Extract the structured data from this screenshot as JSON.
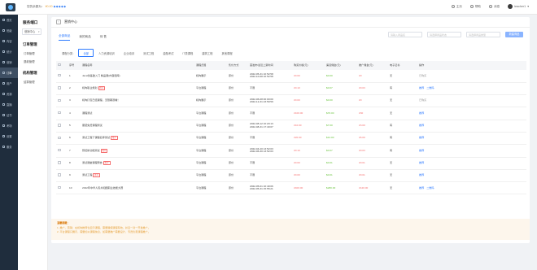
{
  "topbar": {
    "deposit_label": "您的余额为：",
    "deposit_amount": "¥0.00",
    "stars": "◆◆◆◆◆",
    "links": [
      {
        "label": "主页",
        "icon": "home-icon"
      },
      {
        "label": "帮助",
        "icon": "help-icon"
      },
      {
        "label": "消息",
        "icon": "bell-icon"
      }
    ],
    "username": "teacher1"
  },
  "leftnav": {
    "items": [
      {
        "label": "首页",
        "icon": "home-icon"
      },
      {
        "label": "班级",
        "icon": "class-icon"
      },
      {
        "label": "内容",
        "icon": "content-icon"
      },
      {
        "label": "统计",
        "icon": "chart-icon"
      },
      {
        "label": "营销",
        "icon": "marketing-icon"
      },
      {
        "label": "订单",
        "icon": "order-icon",
        "active": true
      },
      {
        "label": "用户",
        "icon": "user-icon"
      },
      {
        "label": "资源",
        "icon": "resource-icon"
      },
      {
        "label": "直播",
        "icon": "live-icon"
      },
      {
        "label": "证书",
        "icon": "certificate-icon"
      },
      {
        "label": "考场",
        "icon": "exam-icon"
      },
      {
        "label": "设置",
        "icon": "settings-icon"
      },
      {
        "label": "服务",
        "icon": "service-icon"
      }
    ]
  },
  "subnav": {
    "title": "服务端口",
    "select_value": "营销中心",
    "groups": [
      {
        "title": "订单管理",
        "links": [
          "订单管理",
          "退款管理"
        ]
      },
      {
        "title": "机构管理",
        "links": [
          "结算管理"
        ]
      }
    ]
  },
  "panel": {
    "title": "营销中心",
    "tabs": [
      {
        "label": "全部商品",
        "active": true
      },
      {
        "label": "我的商品",
        "active": false
      },
      {
        "label": "待 售",
        "active": false
      }
    ],
    "search_placeholder": "请输入商品名",
    "status_placeholder": "请选择商品状态",
    "type_placeholder": "请选择商品类型",
    "add_button": "新建商品",
    "type_label": "课程分类：",
    "types": [
      "全部",
      "人力资源培训",
      "企业培训",
      "测试工程",
      "金融考试",
      "IT类课程",
      "建筑工程",
      "其他课程"
    ]
  },
  "table": {
    "headers": [
      "序号",
      "课程名称",
      "课程归属",
      "售价方式",
      "首发布/最近上架时间",
      "购买价格(元)",
      "渠道佣金(元)",
      "推广佣金(元)",
      "电子证书",
      "操作"
    ],
    "rows": [
      {
        "no": "1",
        "name": "Java零基础入门 精品课(内容题库)",
        "tag": "",
        "owner": "机构展示",
        "mode": "原价",
        "time1": "2022-05-31 10:52:58",
        "time2": "2022-10-08 10:52:58",
        "price": "¥0.00",
        "channel": "$0.00",
        "promo": "¥0",
        "cert": "无",
        "ops": [
          "已购买"
        ],
        "ops_gray": true
      },
      {
        "no": "2",
        "name": "机构职业规划",
        "tag": "推荐",
        "owner": "平台课程",
        "mode": "原价",
        "time1": "不限",
        "time2": "",
        "price": "¥0.10",
        "channel": "$0.07",
        "promo": "¥0.03",
        "cert": "有",
        "ops": [
          "推荐",
          "二维码"
        ],
        "ops_gray": false
      },
      {
        "no": "3",
        "name": "机构打包已结课程，无限期观看！",
        "tag": "",
        "owner": "机构展示",
        "mode": "原价",
        "time1": "2022-06-08 00:00:00",
        "time2": "2022-12-31 23:59:59",
        "price": "¥0.00",
        "channel": "$0.00",
        "promo": "¥0",
        "cert": "无",
        "ops": [
          "已购买"
        ],
        "ops_gray": true
      },
      {
        "no": "4",
        "name": "课程测试",
        "tag": "",
        "owner": "平台课程",
        "mode": "原价",
        "time1": "不限",
        "time2": "",
        "price": "¥100.00",
        "channel": "$70.00",
        "promo": "¥30",
        "cert": "无",
        "ops": [
          "推荐"
        ],
        "ops_gray": false
      },
      {
        "no": "5",
        "name": "服装免费课程测试",
        "tag": "",
        "owner": "平台课程",
        "mode": "原价",
        "time1": "2022-08-12 10:20:13",
        "time2": "2022-08-31 17:40:07",
        "price": "¥10.00",
        "channel": "$7.00",
        "promo": "¥3.00",
        "cert": "有",
        "ops": [
          "推荐"
        ],
        "ops_gray": false
      },
      {
        "no": "6",
        "name": "测试工程下课程名称测试",
        "tag": "推荐",
        "owner": "平台课程",
        "mode": "原价",
        "time1": "不限",
        "time2": "",
        "price": "¥20.00",
        "channel": "$14.00",
        "promo": "¥6.00",
        "cert": "有",
        "ops": [
          "推荐"
        ],
        "ops_gray": false
      },
      {
        "no": "7",
        "name": "预览新功能测试",
        "tag": "推荐",
        "owner": "平台课程",
        "mode": "原价",
        "time1": "2022-04-20 13:52:03",
        "time2": "2022-06-30 13:52:03",
        "price": "¥0.10",
        "channel": "$0.07",
        "promo": "¥0.03",
        "cert": "有",
        "ops": [
          "推荐"
        ],
        "ops_gray": false
      },
      {
        "no": "8",
        "name": "测试课堂课程预告",
        "tag": "推荐",
        "owner": "平台课程",
        "mode": "原价",
        "time1": "不限",
        "time2": "",
        "price": "¥0.00",
        "channel": "$0.01",
        "promo": "¥0.01",
        "cert": "无",
        "ops": [
          "推荐"
        ],
        "ops_gray": false
      },
      {
        "no": "9",
        "name": "测试工程",
        "tag": "推荐",
        "owner": "平台课程",
        "mode": "原价",
        "time1": "不限",
        "time2": "",
        "price": "¥0.00",
        "channel": "$0.01",
        "promo": "¥0.01",
        "cert": "无",
        "ops": [
          "推荐"
        ],
        "ops_gray": false
      },
      {
        "no": "10",
        "name": "2022年中华人民共和国职业技能大赛",
        "tag": "",
        "owner": "平台课程",
        "mode": "原价",
        "time1": "2022-05-01 10:49:06",
        "time2": "2022-05-31 15:55:21",
        "price": "¥400.00",
        "channel": "$280.00",
        "promo": "¥120.00",
        "cert": "无",
        "ops": [
          "推荐",
          "二维码"
        ],
        "ops_gray": false
      }
    ]
  },
  "pager": {
    "prev": "‹",
    "pages": [
      "1",
      "2"
    ],
    "current": "1",
    "next": "›"
  },
  "notes": {
    "title": "温馨提醒：",
    "lines": [
      "1. 推广、营销：在机构推荐位显示课程，需要确保课程有效，并且一对一开发推广。",
      "2. 平台课程只展示，需要加以课程信息，如需要推广需要设计，专员负责课程推广。"
    ]
  }
}
